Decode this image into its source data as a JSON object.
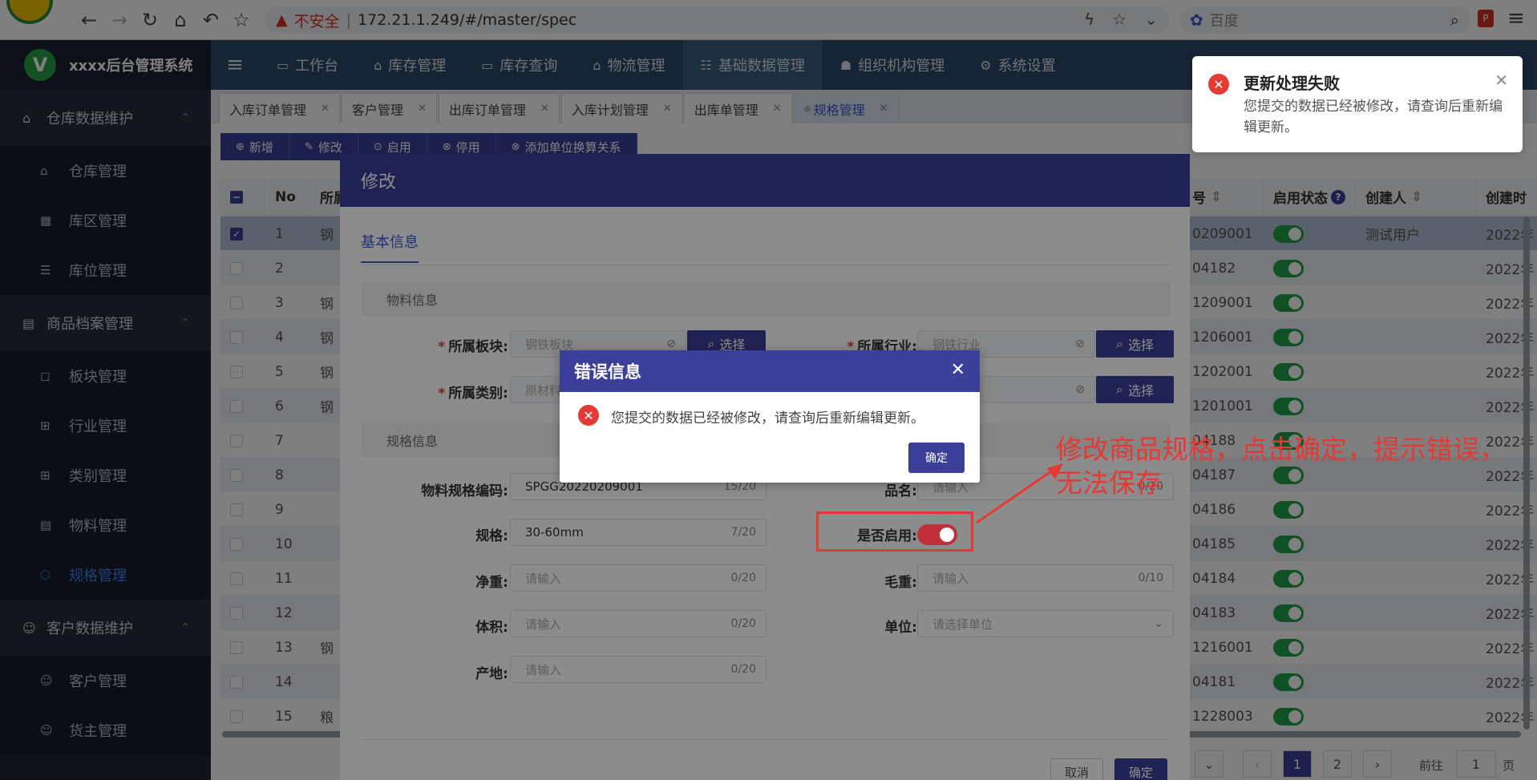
{
  "browser": {
    "security_label": "不安全",
    "url": "172.21.1.249/#/master/spec",
    "search_placeholder": "百度"
  },
  "sidebar": {
    "app_title": "xxxx后台管理系统",
    "logo_letter": "V",
    "groups": [
      {
        "label": "仓库数据维护",
        "items": [
          "仓库管理",
          "库区管理",
          "库位管理"
        ]
      },
      {
        "label": "商品档案管理",
        "items": [
          "板块管理",
          "行业管理",
          "类别管理",
          "物料管理",
          "规格管理"
        ]
      },
      {
        "label": "客户数据维护",
        "items": [
          "客户管理",
          "货主管理"
        ]
      }
    ],
    "active_item": "规格管理"
  },
  "topnav": {
    "items": [
      "工作台",
      "库存管理",
      "库存查询",
      "物流管理",
      "基础数据管理",
      "组织机构管理",
      "系统设置"
    ],
    "active": "基础数据管理"
  },
  "tabs": [
    "入库订单管理",
    "客户管理",
    "出库订单管理",
    "入库计划管理",
    "出库单管理",
    "规格管理"
  ],
  "toolbar": [
    "新增",
    "修改",
    "启用",
    "停用",
    "添加单位换算关系"
  ],
  "table": {
    "headers": {
      "no": "No",
      "col2": "所属",
      "col_code": "号",
      "status": "启用状态",
      "creator": "创建人",
      "created": "创建时"
    },
    "rows": [
      {
        "no": "1",
        "c2": "钢",
        "code": "0209001",
        "creator": "测试用户",
        "created": "2022年"
      },
      {
        "no": "2",
        "c2": "",
        "code": "04182",
        "creator": "",
        "created": "2022年"
      },
      {
        "no": "3",
        "c2": "钢",
        "code": "1209001",
        "creator": "",
        "created": "2022年"
      },
      {
        "no": "4",
        "c2": "钢",
        "code": "1206001",
        "creator": "",
        "created": "2022年"
      },
      {
        "no": "5",
        "c2": "钢",
        "code": "1202001",
        "creator": "",
        "created": "2022年"
      },
      {
        "no": "6",
        "c2": "钢",
        "code": "1201001",
        "creator": "",
        "created": "2022年"
      },
      {
        "no": "7",
        "c2": "",
        "code": "04188",
        "creator": "",
        "created": "2022年"
      },
      {
        "no": "8",
        "c2": "",
        "code": "04187",
        "creator": "",
        "created": "2022年"
      },
      {
        "no": "9",
        "c2": "",
        "code": "04186",
        "creator": "",
        "created": "2022年"
      },
      {
        "no": "10",
        "c2": "",
        "code": "04185",
        "creator": "",
        "created": "2022年"
      },
      {
        "no": "11",
        "c2": "",
        "code": "04184",
        "creator": "",
        "created": "2022年"
      },
      {
        "no": "12",
        "c2": "",
        "code": "04183",
        "creator": "",
        "created": "2022年"
      },
      {
        "no": "13",
        "c2": "钢",
        "code": "1216001",
        "creator": "",
        "created": "2022年"
      },
      {
        "no": "14",
        "c2": "",
        "code": "04181",
        "creator": "",
        "created": "2022年"
      },
      {
        "no": "15",
        "c2": "粮",
        "code": "1228003",
        "creator": "",
        "created": "2022年"
      }
    ]
  },
  "pager": {
    "page1": "1",
    "page2": "2",
    "goto_label": "前往",
    "goto_value": "1",
    "page_suffix": "页"
  },
  "modal": {
    "title": "修改",
    "tab": "基本信息",
    "section_material": "物料信息",
    "section_spec": "规格信息",
    "fields": {
      "block_label": "所属板块:",
      "block_placeholder": "钢铁板块",
      "industry_label": "所属行业:",
      "industry_placeholder": "钢铁行业",
      "category_label": "所属类别:",
      "category_placeholder": "原材料",
      "select_btn": "选择",
      "code_label": "物料规格编码:",
      "code_value": "SPGG20220209001",
      "code_count": "15/20",
      "name_label": "品名:",
      "name_placeholder": "请输入",
      "name_count": "0/20",
      "spec_label": "规格:",
      "spec_value": "30-60mm",
      "spec_count": "7/20",
      "enabled_label": "是否启用:",
      "net_label": "净重:",
      "net_placeholder": "请输入",
      "net_count": "0/20",
      "gross_label": "毛重:",
      "gross_placeholder": "请输入",
      "gross_count": "0/10",
      "volume_label": "体积:",
      "volume_placeholder": "请输入",
      "volume_count": "0/20",
      "unit_label": "单位:",
      "unit_placeholder": "请选择单位",
      "origin_label": "产地:",
      "origin_placeholder": "请输入",
      "origin_count": "0/20"
    },
    "cancel": "取消",
    "confirm": "确定"
  },
  "error_dialog": {
    "title": "错误信息",
    "message": "您提交的数据已经被修改，请查询后重新编辑更新。",
    "ok": "确定"
  },
  "notification": {
    "title": "更新处理失败",
    "message": "您提交的数据已经被修改，请查询后重新编辑更新。"
  },
  "annotation": "修改商品规格，点击确定，提示错误，无法保存",
  "colors": {
    "primary": "#3b3f9a",
    "error": "#e53935",
    "toggle_on": "#1fa349",
    "sidebar": "#1f2433",
    "topnav": "#2c4a6b"
  }
}
